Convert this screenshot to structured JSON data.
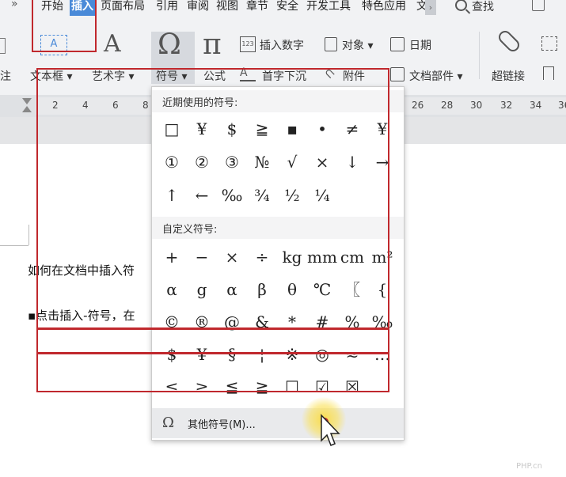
{
  "menubar": {
    "tabs": [
      "开始",
      "插入",
      "页面布局",
      "引用",
      "审阅",
      "视图",
      "章节",
      "安全",
      "开发工具",
      "特色应用",
      "文"
    ],
    "active_tab": "插入",
    "search_label": "查找"
  },
  "ribbon": {
    "textbox_label": "文本框",
    "wordart_label": "艺术字",
    "symbol_label": "符号",
    "formula_label": "公式",
    "insert_number_label": "插入数字",
    "object_label": "对象",
    "date_label": "日期",
    "dropcap_label": "首字下沉",
    "attachment_label": "附件",
    "docparts_label": "文档部件",
    "hyperlink_label": "超链接",
    "left_partial_label": "注"
  },
  "ruler": {
    "numbers": [
      "2",
      "4",
      "6",
      "8",
      "26",
      "28",
      "30",
      "32",
      "34",
      "36"
    ]
  },
  "document": {
    "line1": "如何在文档中插入符",
    "line2": "▪点击插入-符号，在"
  },
  "symbol_panel": {
    "recent_title": "近期使用的符号:",
    "recent_symbols": [
      "□",
      "¥",
      "$",
      "≧",
      "▪",
      "•",
      "≠",
      "¥",
      "①",
      "②",
      "③",
      "№",
      "√",
      "×",
      "↓",
      "→",
      "↑",
      "←",
      "‰",
      "¾",
      "½",
      "¼"
    ],
    "custom_title": "自定义符号:",
    "custom_symbols": [
      "+",
      "−",
      "×",
      "÷",
      "kg",
      "mm",
      "cm",
      "m²",
      "α",
      "g",
      "α",
      "β",
      "θ",
      "℃",
      "〖",
      "{",
      "©",
      "®",
      "@",
      "&",
      "*",
      "#",
      "%",
      "‰",
      "$",
      "¥",
      "§",
      "¦",
      "※",
      "◎",
      "≈",
      "…",
      "≤",
      "≥",
      "≦",
      "≧",
      "☐",
      "☑",
      "☒"
    ],
    "more_symbols_label": "其他符号(M)..."
  },
  "watermark": "PHP.cn",
  "colors": {
    "accent": "#4a8ad8",
    "annotation": "#c0282d",
    "ribbon_bg": "#f1f2f4"
  }
}
